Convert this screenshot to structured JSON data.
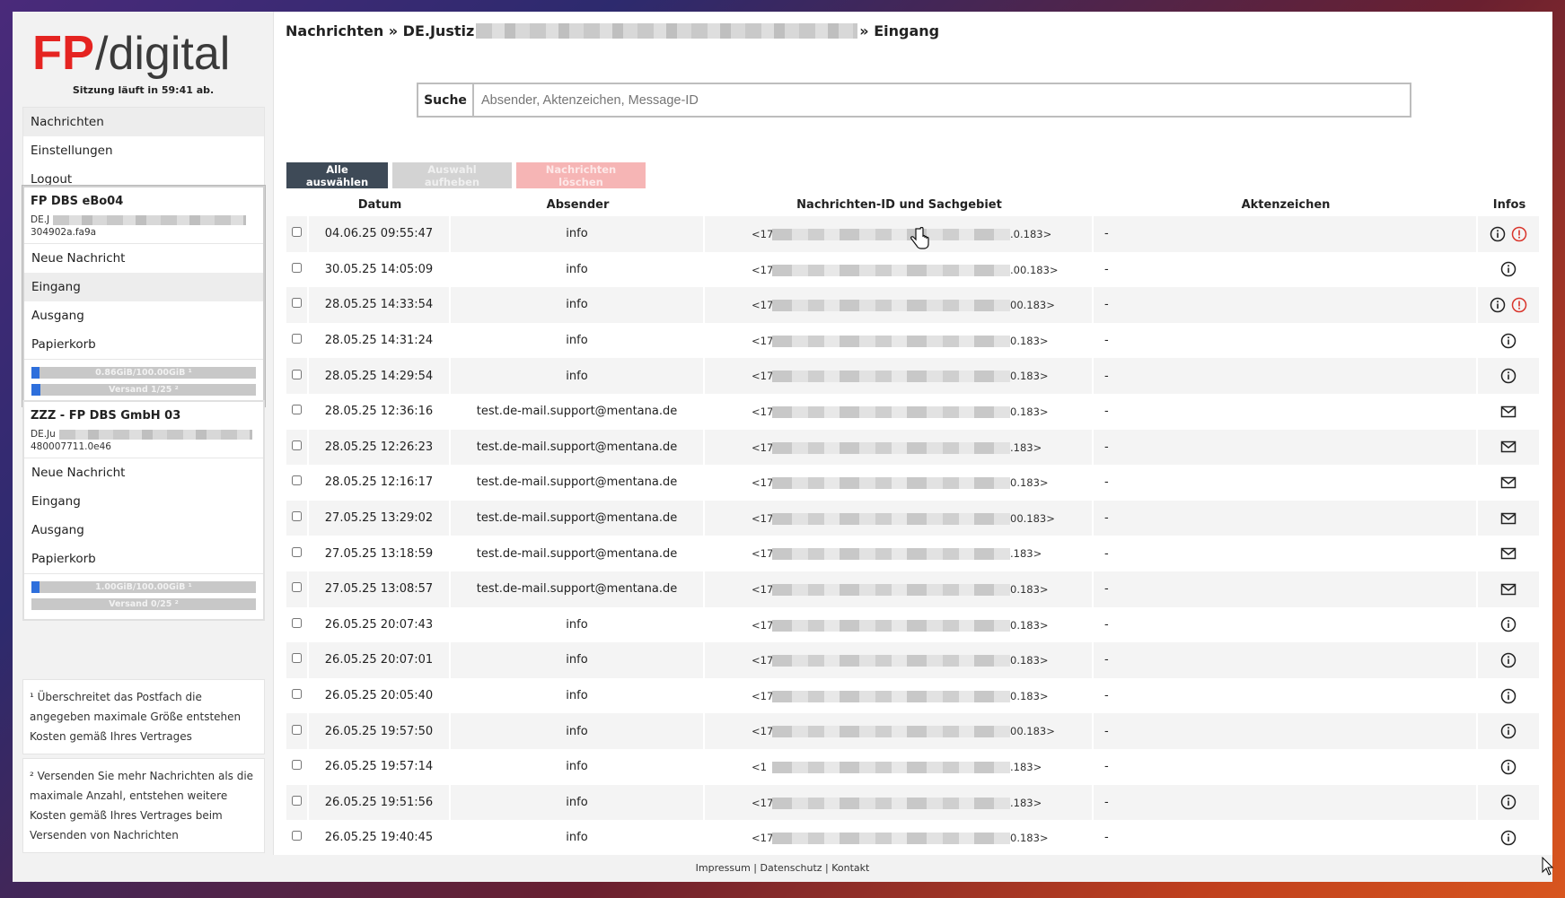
{
  "brand": {
    "logo_fp": "FP",
    "logo_digital": "/digital"
  },
  "session": "Sitzung läuft in 59:41 ab.",
  "main_menu": [
    {
      "label": "Nachrichten"
    },
    {
      "label": "Einstellungen"
    },
    {
      "label": "Logout"
    }
  ],
  "accounts": [
    {
      "name": "FP DBS eBo04",
      "id_prefix": "DE.J",
      "code": "304902a.fa9a",
      "items": [
        "Neue Nachricht",
        "Eingang",
        "Ausgang",
        "Papierkorb"
      ],
      "storage": "0.86GiB/100.00GiB ¹",
      "storage_fraction": 0.0086,
      "sent": "Versand 1/25 ²",
      "sent_fraction": 0.04
    },
    {
      "name": "ZZZ - FP DBS GmbH 03",
      "id_prefix": "DE.Ju",
      "code": "480007711.0e46",
      "items": [
        "Neue Nachricht",
        "Eingang",
        "Ausgang",
        "Papierkorb"
      ],
      "storage": "1.00GiB/100.00GiB ¹",
      "storage_fraction": 0.01,
      "sent": "Versand 0/25 ²",
      "sent_fraction": 0
    }
  ],
  "notes": [
    "¹ Überschreitet das Postfach die angegeben maximale Größe entstehen Kosten gemäß Ihres Vertrages",
    "² Versenden Sie mehr Nachrichten als die maximale Anzahl, entstehen weitere Kosten gemäß Ihres Vertrages beim Versenden von Nachrichten"
  ],
  "breadcrumb": {
    "part1": "Nachrichten » DE.Justiz",
    "part2": "» Eingang"
  },
  "search": {
    "label": "Suche",
    "placeholder": "Absender, Aktenzeichen, Message-ID"
  },
  "buttons": {
    "select_all": "Alle auswählen",
    "deselect": "Auswahl aufheben",
    "delete": "Nachrichten löschen"
  },
  "columns": [
    "Datum",
    "Absender",
    "Nachrichten-ID und Sachgebiet",
    "Aktenzeichen",
    "Infos"
  ],
  "rows": [
    {
      "date": "04.06.25 09:55:47",
      "sender": "info",
      "id_start": "<174",
      "id_end": ".0.183>",
      "akz": "-",
      "icons": [
        "info-icon",
        "alert-icon"
      ]
    },
    {
      "date": "30.05.25 14:05:09",
      "sender": "info",
      "id_start": "<174",
      "id_end": ".00.183>",
      "akz": "-",
      "icons": [
        "info-icon"
      ]
    },
    {
      "date": "28.05.25 14:33:54",
      "sender": "info",
      "id_start": "<174",
      "id_end": "00.183>",
      "akz": "-",
      "icons": [
        "info-icon",
        "alert-icon"
      ]
    },
    {
      "date": "28.05.25 14:31:24",
      "sender": "info",
      "id_start": "<17",
      "id_end": "0.183>",
      "akz": "-",
      "icons": [
        "info-icon"
      ]
    },
    {
      "date": "28.05.25 14:29:54",
      "sender": "info",
      "id_start": "<174",
      "id_end": "0.183>",
      "akz": "-",
      "icons": [
        "info-icon"
      ]
    },
    {
      "date": "28.05.25 12:36:16",
      "sender": "test.de-mail.support@mentana.de",
      "id_start": "<17",
      "id_end": "0.183>",
      "akz": "-",
      "icons": [
        "mail-icon"
      ]
    },
    {
      "date": "28.05.25 12:26:23",
      "sender": "test.de-mail.support@mentana.de",
      "id_start": "<17",
      "id_end": ".183>",
      "akz": "-",
      "icons": [
        "mail-icon"
      ]
    },
    {
      "date": "28.05.25 12:16:17",
      "sender": "test.de-mail.support@mentana.de",
      "id_start": "<17",
      "id_end": "0.183>",
      "akz": "-",
      "icons": [
        "mail-icon"
      ]
    },
    {
      "date": "27.05.25 13:29:02",
      "sender": "test.de-mail.support@mentana.de",
      "id_start": "<174",
      "id_end": "00.183>",
      "akz": "-",
      "icons": [
        "mail-icon"
      ]
    },
    {
      "date": "27.05.25 13:18:59",
      "sender": "test.de-mail.support@mentana.de",
      "id_start": "<17",
      "id_end": ".183>",
      "akz": "-",
      "icons": [
        "mail-icon"
      ]
    },
    {
      "date": "27.05.25 13:08:57",
      "sender": "test.de-mail.support@mentana.de",
      "id_start": "<17",
      "id_end": "0.183>",
      "akz": "-",
      "icons": [
        "mail-icon"
      ]
    },
    {
      "date": "26.05.25 20:07:43",
      "sender": "info",
      "id_start": "<174",
      "id_end": "0.183>",
      "akz": "-",
      "icons": [
        "info-icon"
      ]
    },
    {
      "date": "26.05.25 20:07:01",
      "sender": "info",
      "id_start": "<17",
      "id_end": "0.183>",
      "akz": "-",
      "icons": [
        "info-icon"
      ]
    },
    {
      "date": "26.05.25 20:05:40",
      "sender": "info",
      "id_start": "<174",
      "id_end": "0.183>",
      "akz": "-",
      "icons": [
        "info-icon"
      ]
    },
    {
      "date": "26.05.25 19:57:50",
      "sender": "info",
      "id_start": "<174",
      "id_end": "00.183>",
      "akz": "-",
      "icons": [
        "info-icon"
      ]
    },
    {
      "date": "26.05.25 19:57:14",
      "sender": "info",
      "id_start": "<1",
      "id_end": ".183>",
      "akz": "-",
      "icons": [
        "info-icon"
      ]
    },
    {
      "date": "26.05.25 19:51:56",
      "sender": "info",
      "id_start": "<17",
      "id_end": ".183>",
      "akz": "-",
      "icons": [
        "info-icon"
      ]
    },
    {
      "date": "26.05.25 19:40:45",
      "sender": "info",
      "id_start": "<174",
      "id_end": "0.183>",
      "akz": "-",
      "icons": [
        "info-icon"
      ]
    }
  ],
  "footer": "Impressum | Datenschutz | Kontakt",
  "colors": {
    "brand_red": "#e52421",
    "dark_button": "#3e4a57",
    "alert_red": "#d9342b",
    "meter_blue": "#2e6fdc"
  }
}
